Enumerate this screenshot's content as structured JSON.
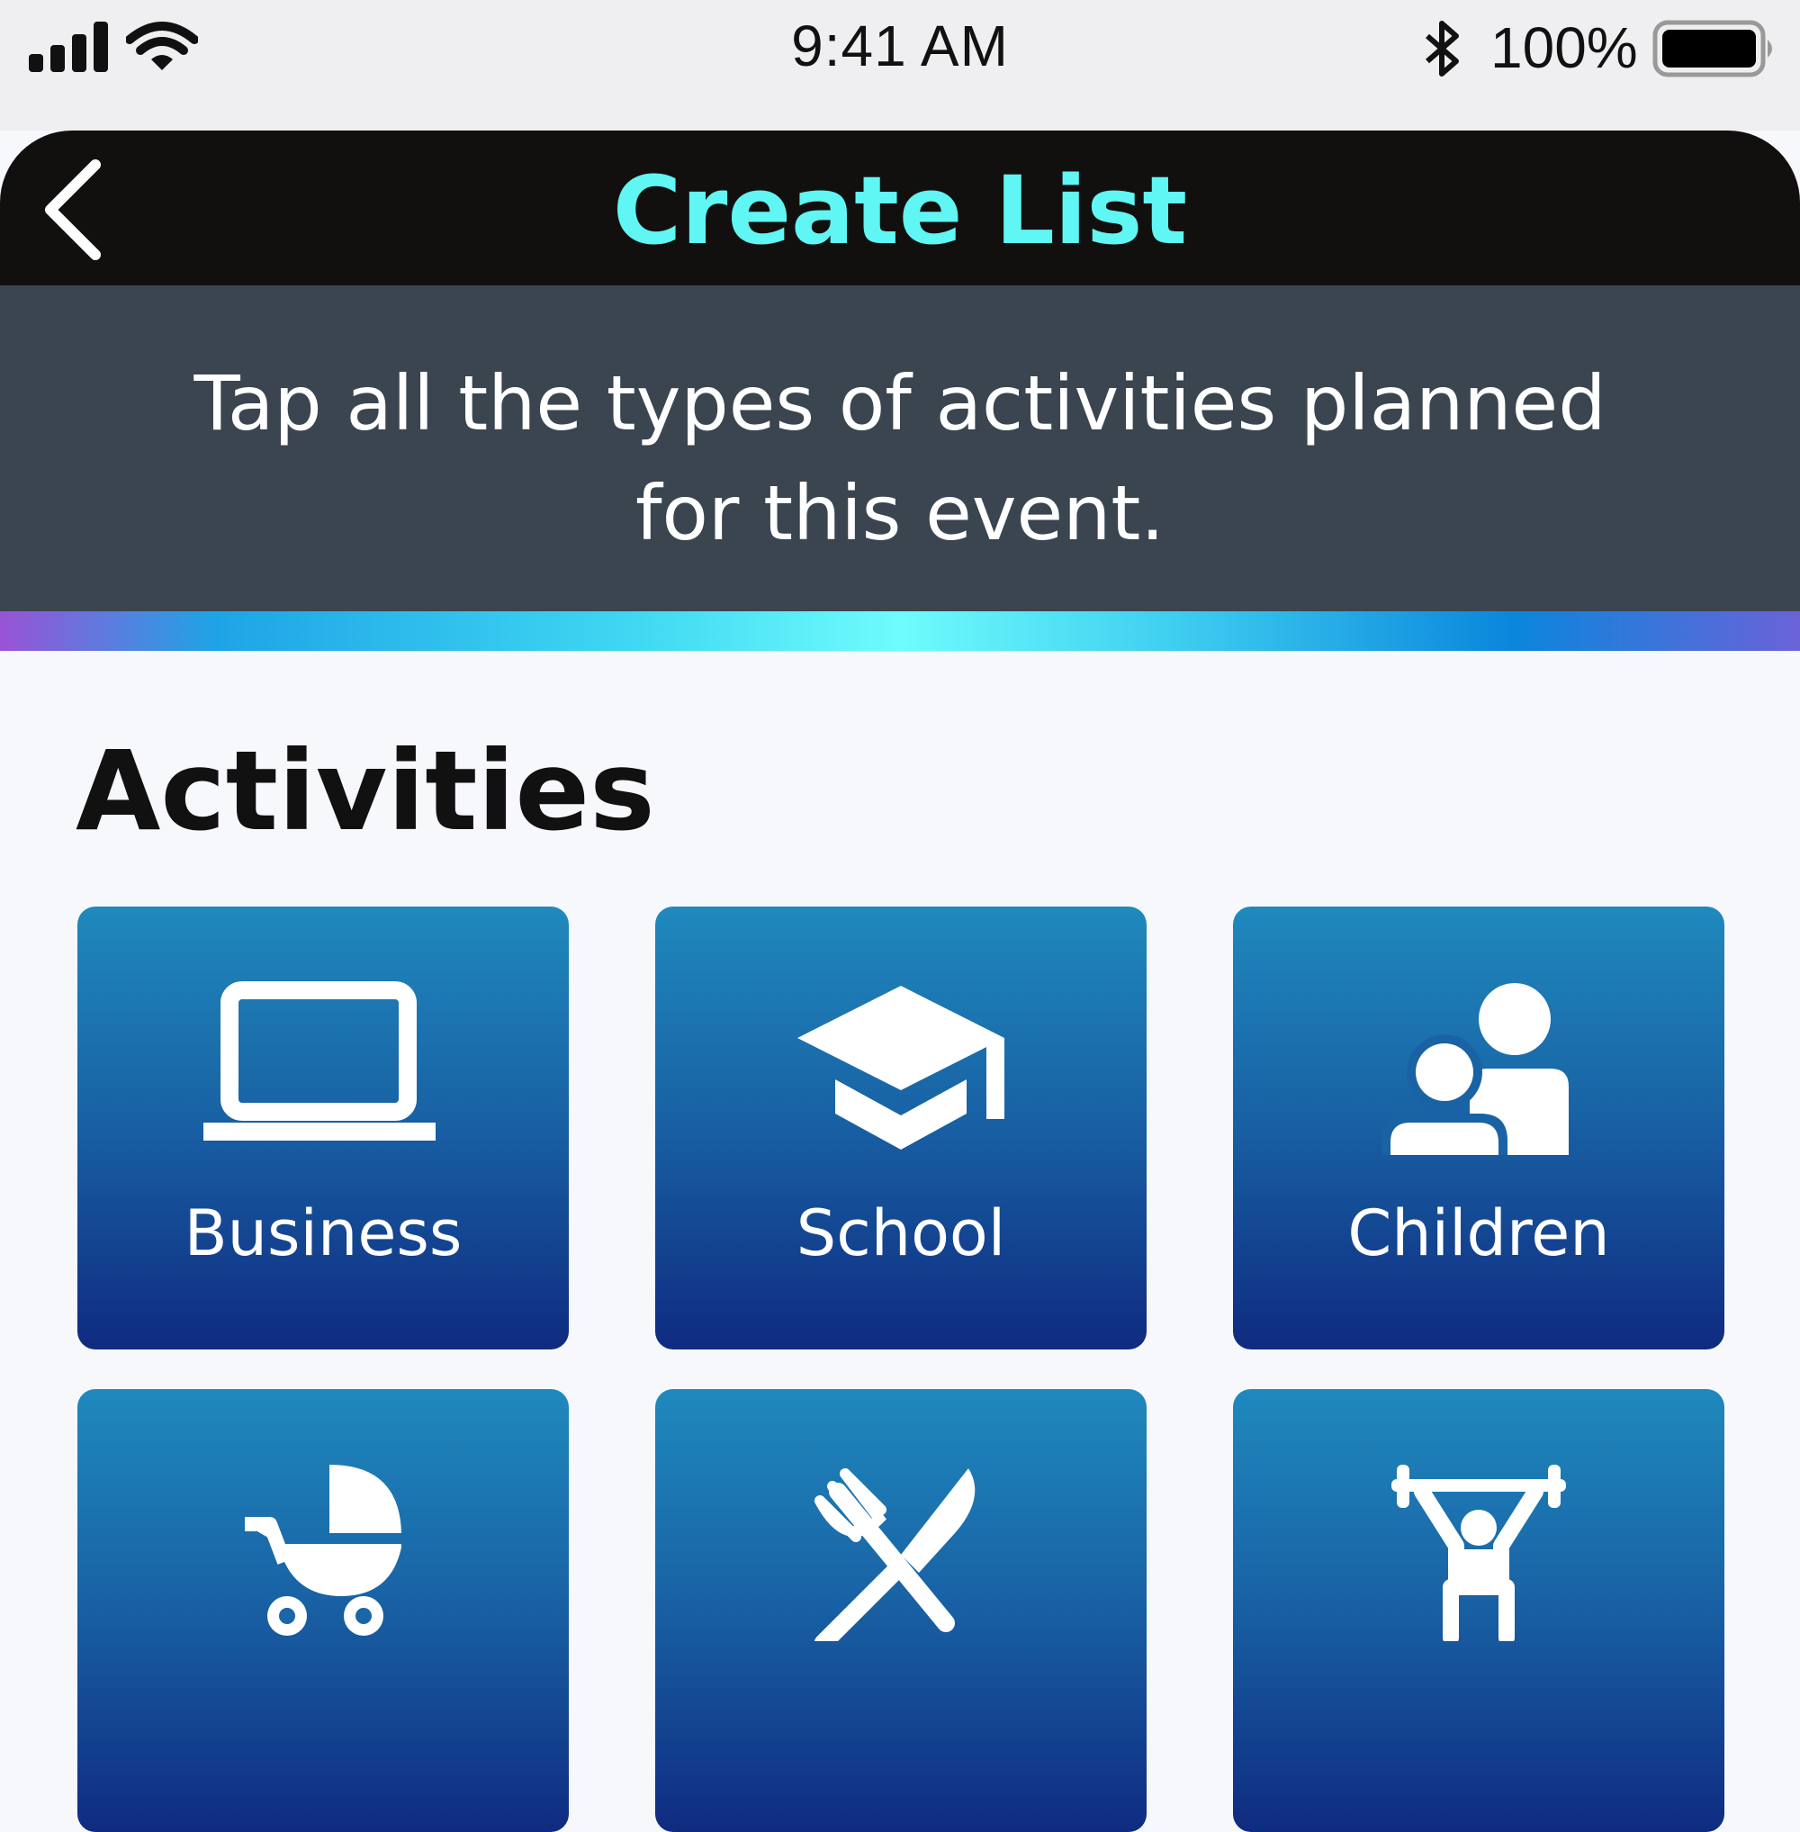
{
  "status_bar": {
    "time": "9:41 AM",
    "battery_percent": "100%",
    "icons": [
      "signal-icon",
      "wifi-icon",
      "bluetooth-icon",
      "battery-icon"
    ]
  },
  "header": {
    "title": "Create List",
    "back_icon": "chevron-left-icon",
    "title_color": "#5ff6f4"
  },
  "banner": {
    "text": "Tap all the types of activities planned for this event."
  },
  "section": {
    "title": "Activities"
  },
  "tiles": [
    {
      "label": "Business",
      "icon": "laptop-icon"
    },
    {
      "label": "School",
      "icon": "graduation-cap-icon"
    },
    {
      "label": "Children",
      "icon": "parent-child-icon"
    },
    {
      "label": "",
      "icon": "stroller-icon"
    },
    {
      "label": "",
      "icon": "fork-knife-icon"
    },
    {
      "label": "",
      "icon": "weightlifting-icon"
    }
  ],
  "colors": {
    "tile_top": "#1f89bd",
    "tile_bottom": "#0f2b80",
    "banner_bg": "#3a4550",
    "header_bg": "#12100e"
  }
}
